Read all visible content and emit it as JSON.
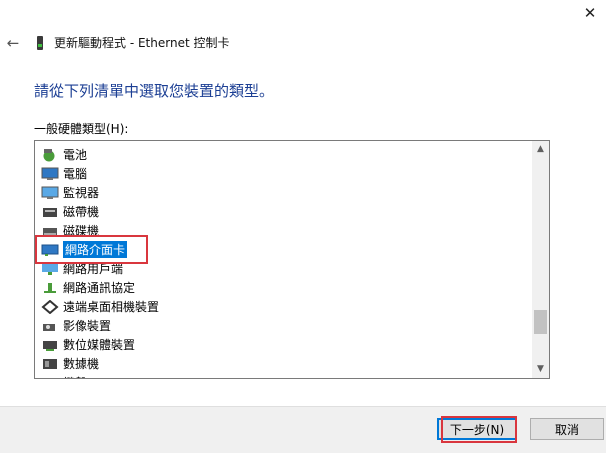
{
  "window": {
    "close_glyph": "✕"
  },
  "wizard": {
    "back_glyph": "←",
    "title": "更新驅動程式 - Ethernet 控制卡",
    "heading": "請從下列清單中選取您裝置的類型。",
    "list_label": "一般硬體類型(H):"
  },
  "hardware_types": [
    {
      "label": "電池",
      "icon": "battery-icon"
    },
    {
      "label": "電腦",
      "icon": "computer-icon"
    },
    {
      "label": "監視器",
      "icon": "monitor-icon"
    },
    {
      "label": "磁帶機",
      "icon": "tape-drive-icon"
    },
    {
      "label": "磁碟機",
      "icon": "disk-drive-icon"
    },
    {
      "label": "網路介面卡",
      "icon": "network-adapter-icon",
      "selected": true
    },
    {
      "label": "網路用戶端",
      "icon": "network-client-icon"
    },
    {
      "label": "網路通訊協定",
      "icon": "network-protocol-icon"
    },
    {
      "label": "遠端桌面相機裝置",
      "icon": "remote-camera-icon"
    },
    {
      "label": "影像裝置",
      "icon": "imaging-device-icon"
    },
    {
      "label": "數位媒體裝置",
      "icon": "digital-media-icon"
    },
    {
      "label": "數據機",
      "icon": "modem-icon"
    },
    {
      "label": "鍵盤",
      "icon": "keyboard-icon"
    }
  ],
  "scrollbar": {
    "up_glyph": "▲",
    "down_glyph": "▼",
    "position_fraction": 0.85
  },
  "buttons": {
    "next": "下一步(N)",
    "cancel": "取消"
  },
  "colors": {
    "heading": "#1c3f94",
    "selection": "#0078d7",
    "highlight": "#d9363e"
  }
}
